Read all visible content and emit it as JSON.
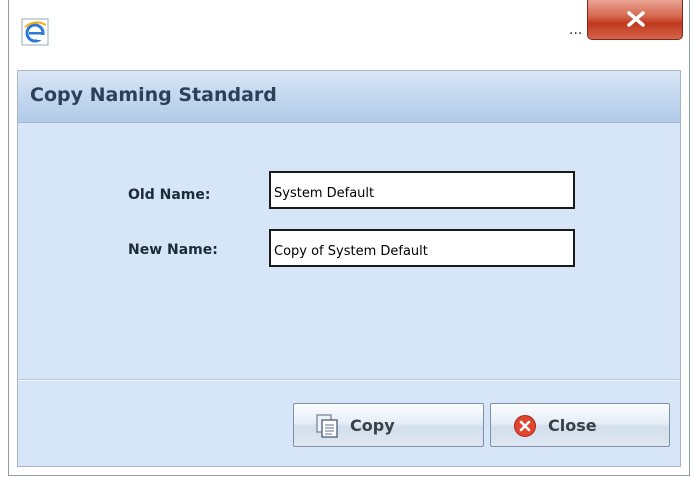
{
  "window": {
    "app_icon": "internet-explorer-icon",
    "ellipsis": "...",
    "close_icon": "close-x-icon"
  },
  "dialog": {
    "title": "Copy Naming Standard",
    "fields": [
      {
        "label": "Old Name:",
        "value": "System Default"
      },
      {
        "label": "New Name:",
        "value": "Copy of System Default"
      }
    ],
    "buttons": {
      "copy_label": "Copy",
      "copy_icon": "copy-documents-icon",
      "close_label": "Close",
      "close_icon": "red-x-circle-icon"
    }
  },
  "colors": {
    "header_text": "#2e4058",
    "panel_background": "#d6e5f8",
    "close_red": "#c0391f"
  }
}
